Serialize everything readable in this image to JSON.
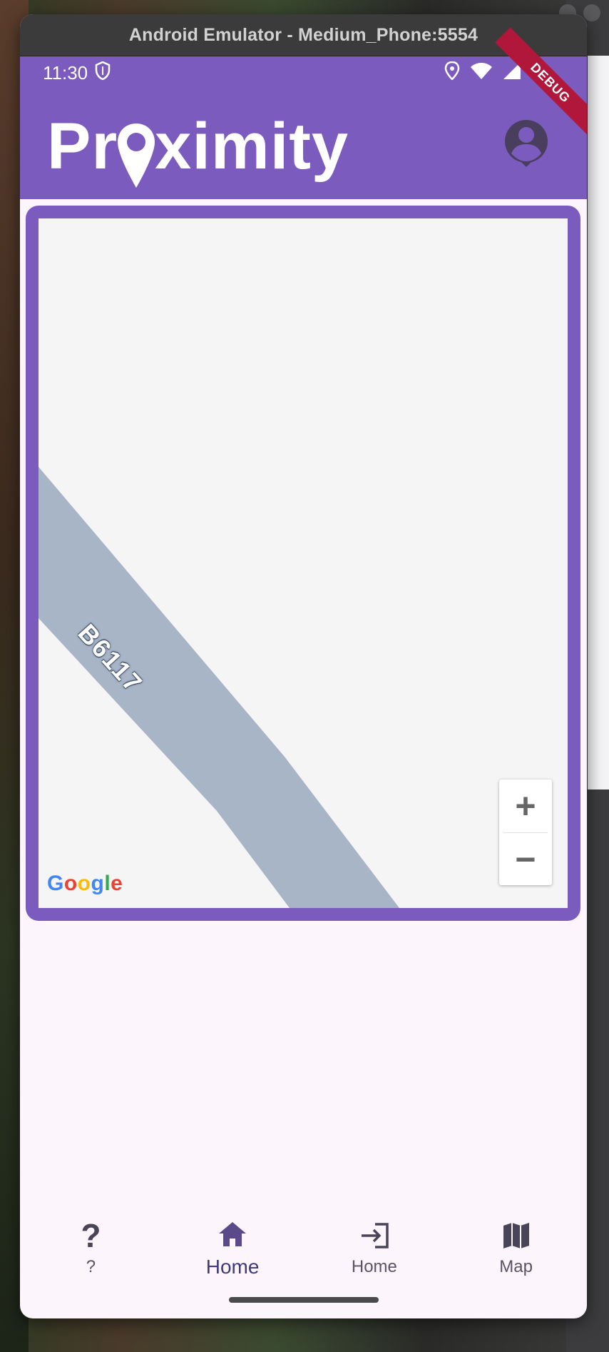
{
  "window": {
    "title": "Android Emulator - Medium_Phone:5554"
  },
  "status_bar": {
    "time": "11:30"
  },
  "debug_banner": "DEBUG",
  "app": {
    "logo_text_before": "Pr",
    "logo_text_after": "ximity"
  },
  "map": {
    "road_label": "B6117",
    "attribution": "Google",
    "zoom_in": "+",
    "zoom_out": "−"
  },
  "nav": {
    "items": [
      {
        "label": "?",
        "icon": "question-icon"
      },
      {
        "label": "Home",
        "icon": "home-icon",
        "active": true
      },
      {
        "label": "Home",
        "icon": "login-icon"
      },
      {
        "label": "Map",
        "icon": "map-icon"
      }
    ]
  },
  "colors": {
    "primary": "#7b5cbe",
    "debug": "#b0173a",
    "road": "#a7b5c7",
    "map_bg": "#f5f5f5"
  }
}
